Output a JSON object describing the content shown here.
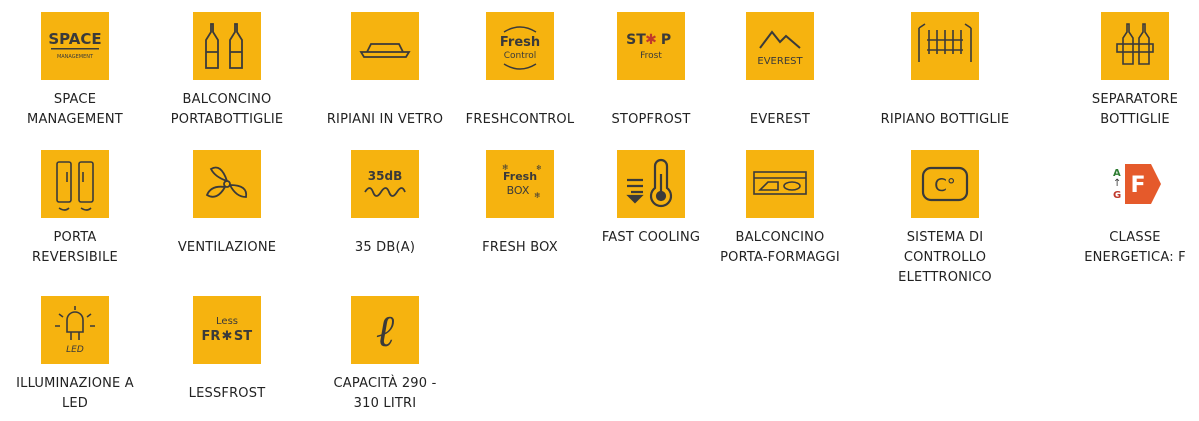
{
  "accent_color": "#f6b30f",
  "features": [
    {
      "label": "SPACE MANAGEMENT",
      "icon": "space-management-icon"
    },
    {
      "label": "BALCONCINO PORTABOTTIGLIE",
      "icon": "bottles-balcony-icon"
    },
    {
      "label": "RIPIANI IN VETRO",
      "icon": "glass-shelf-icon"
    },
    {
      "label": "FRESHCONTROL",
      "icon": "fresh-control-icon"
    },
    {
      "label": "STOPFROST",
      "icon": "stop-frost-icon"
    },
    {
      "label": "EVEREST",
      "icon": "everest-icon"
    },
    {
      "label": "RIPIANO BOTTIGLIE",
      "icon": "bottle-shelf-icon"
    },
    {
      "label": "SEPARATORE BOTTIGLIE",
      "icon": "bottle-separator-icon"
    },
    {
      "label": "PORTA REVERSIBILE",
      "icon": "reversible-door-icon"
    },
    {
      "label": "VENTILAZIONE",
      "icon": "fan-icon"
    },
    {
      "label": "35 DB(A)",
      "icon": "noise-35db-icon"
    },
    {
      "label": "FRESH BOX",
      "icon": "fresh-box-icon"
    },
    {
      "label": "FAST COOLING",
      "icon": "fast-cooling-icon"
    },
    {
      "label": "BALCONCINO PORTA-FORMAGGI",
      "icon": "cheese-balcony-icon"
    },
    {
      "label": "SISTEMA DI CONTROLLO ELETTRONICO",
      "icon": "electronic-control-icon"
    },
    {
      "label": "CLASSE ENERGETICA: F",
      "icon": "energy-class-icon"
    },
    {
      "label": "ILLUMINAZIONE A LED",
      "icon": "led-light-icon"
    },
    {
      "label": "LESSFROST",
      "icon": "less-frost-icon"
    },
    {
      "label": "CAPACITÀ 290 - 310 LITRI",
      "icon": "capacity-icon"
    }
  ],
  "icon_text": {
    "space_top": "SPACE",
    "space_bottom": "MANAGEMENT",
    "fresh": "Fresh",
    "control": "Control",
    "stop": "ST",
    "stop_p": "P",
    "frost": "Frost",
    "everest": "EVEREST",
    "db": "35dB",
    "freshbox_1": "Fresh",
    "freshbox_2": "BOX",
    "temp_unit": "C°",
    "energy_a": "A",
    "energy_g": "G",
    "energy_class": "F",
    "led": "LED",
    "less": "Less",
    "less_frost": "FR",
    "less_st": "ST",
    "litre": "ℓ"
  }
}
